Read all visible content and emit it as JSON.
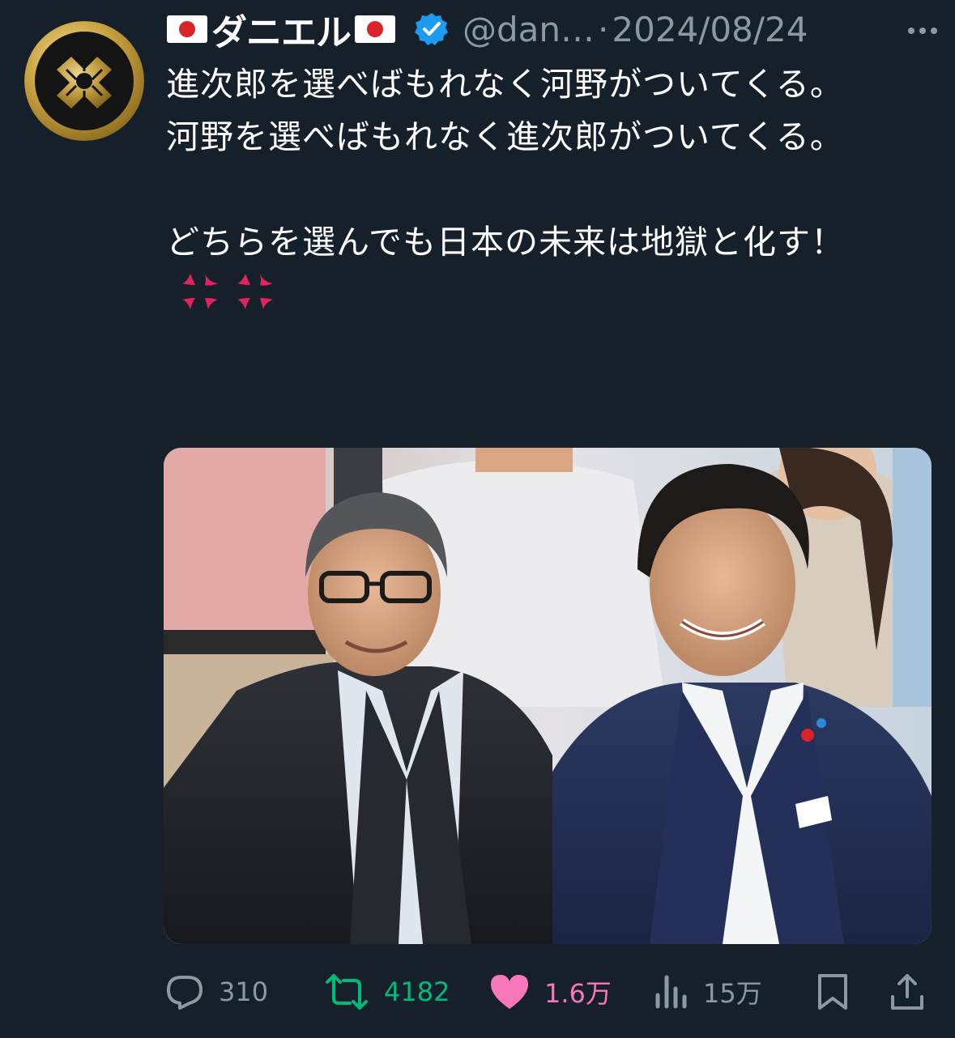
{
  "author": {
    "flag_left": "🇯🇵",
    "display_name": "ダニエル",
    "flag_right": "🇯🇵",
    "handle": "@dan…",
    "separator": "·",
    "date": "2024/08/24"
  },
  "tweet": {
    "text": "進次郎を選べばもれなく河野がついてくる。\n河野を選べばもれなく進次郎がついてくる。\n\nどちらを選んでも日本の未来は地獄と化す！",
    "emoji": [
      "anger-symbol",
      "anger-symbol"
    ]
  },
  "media": {
    "alt": "photo"
  },
  "metrics": {
    "replies": "310",
    "reposts": "4182",
    "likes": "1.6万",
    "views": "15万"
  },
  "colors": {
    "background": "#15202b",
    "muted": "#8b98a5",
    "repost_active": "#00ba7c",
    "like_active": "#f91880",
    "verified": "#1d9bf0",
    "anger": "#e0245e"
  },
  "icons": [
    "flag-japan-icon",
    "verified-badge-icon",
    "more-icon",
    "reply-icon",
    "repost-icon",
    "like-icon",
    "views-icon",
    "bookmark-icon",
    "share-icon"
  ]
}
